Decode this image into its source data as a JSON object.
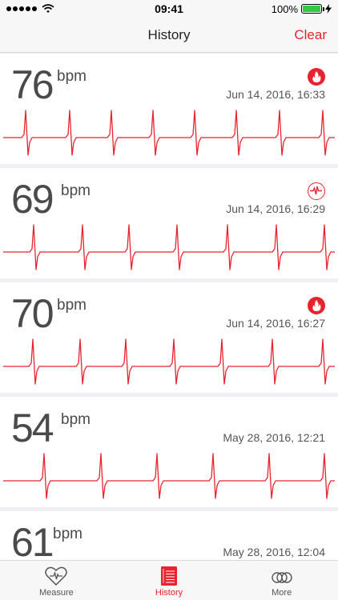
{
  "status": {
    "time": "09:41",
    "battery": "100%"
  },
  "nav": {
    "title": "History",
    "clear": "Clear"
  },
  "entries": [
    {
      "bpm": "76",
      "unit": "bpm",
      "date": "Jun 14, 2016, 16:33",
      "badge": "flame-icon"
    },
    {
      "bpm": "69",
      "unit": "bpm",
      "date": "Jun 14, 2016, 16:29",
      "badge": "pulse-icon"
    },
    {
      "bpm": "70",
      "unit": "bpm",
      "date": "Jun 14, 2016, 16:27",
      "badge": "flame-icon"
    },
    {
      "bpm": "54",
      "unit": "bpm",
      "date": "May 28, 2016, 12:21",
      "badge": ""
    },
    {
      "bpm": "61",
      "unit": "bpm",
      "date": "May 28, 2016, 12:04",
      "badge": ""
    }
  ],
  "tabs": [
    {
      "label": "Measure",
      "icon": "heart-pulse-icon",
      "active": false
    },
    {
      "label": "History",
      "icon": "journal-icon",
      "active": true
    },
    {
      "label": "More",
      "icon": "more-circles-icon",
      "active": false
    }
  ],
  "colors": {
    "accent": "#e8232e",
    "battery": "#2ecc40"
  }
}
